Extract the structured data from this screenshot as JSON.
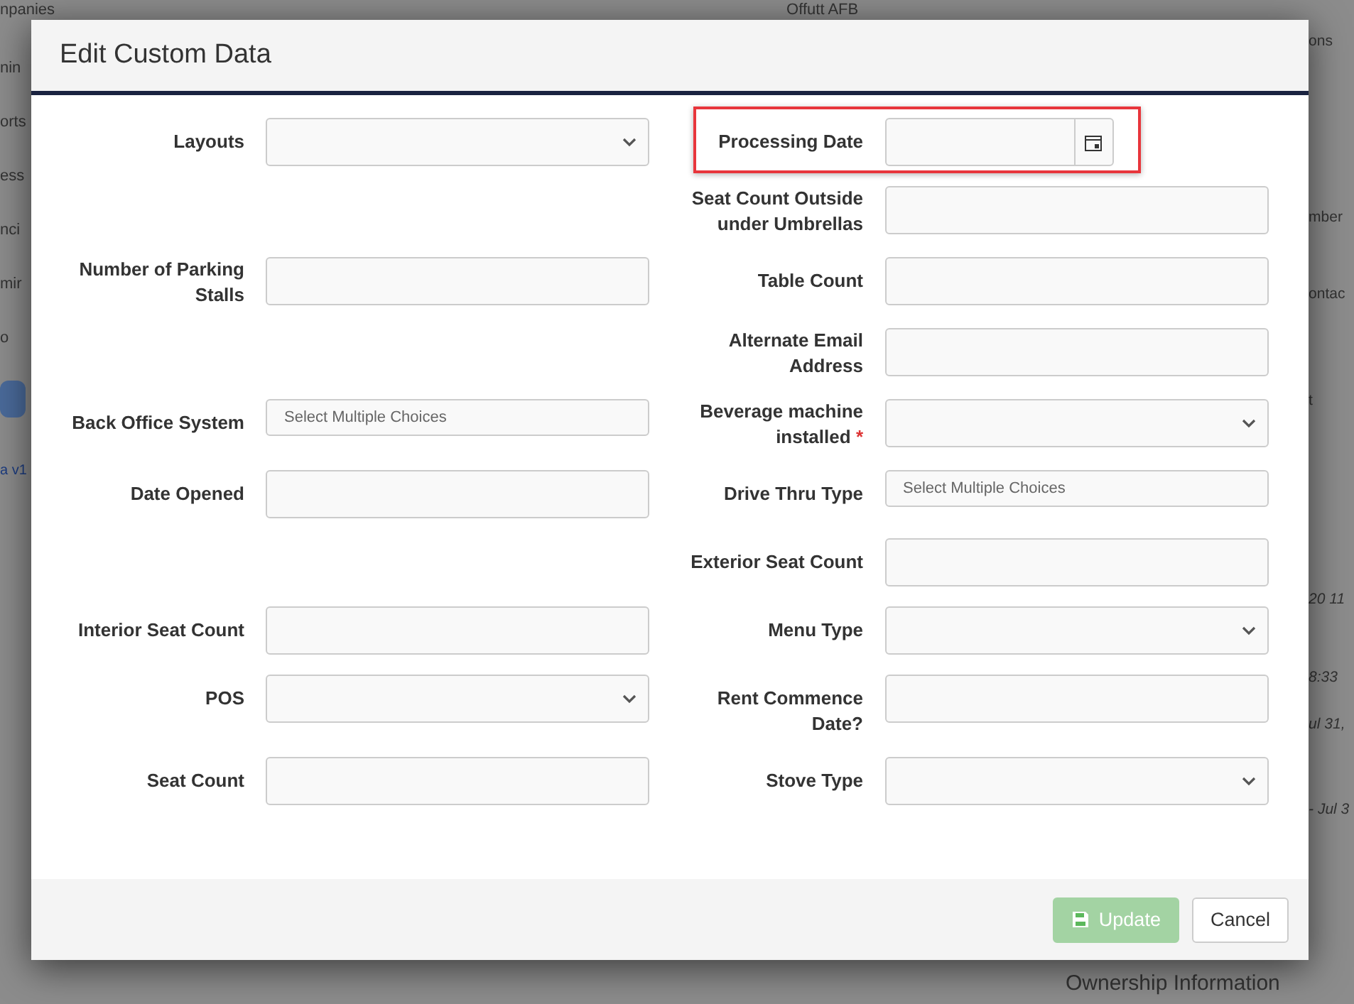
{
  "background": {
    "top_left": "npanies",
    "sidebar_items": [
      "nin",
      "orts",
      "ess",
      "nci",
      "mir",
      "o"
    ],
    "version": "a v1",
    "top_label": "Offutt AFB",
    "right_items": [
      {
        "text": "ons",
        "italic": false
      },
      {
        "text": "mber",
        "italic": false
      },
      {
        "text": "ontac",
        "italic": false
      },
      {
        "text": "t",
        "italic": false
      },
      {
        "text": "20 11",
        "italic": true
      },
      {
        "text": "8:33",
        "italic": true
      },
      {
        "text": "ul 31,",
        "italic": true
      },
      {
        "text": "- Jul 3",
        "italic": true
      }
    ],
    "bottom_heading": "Ownership Information"
  },
  "dialog": {
    "title": "Edit Custom Data",
    "rows": [
      {
        "left": {
          "label": "Layouts",
          "kind": "select"
        },
        "right": {
          "label": "Processing Date",
          "kind": "date",
          "highlighted": true
        }
      },
      {
        "right": {
          "label": "Seat Count Outside under Umbrellas",
          "kind": "text"
        }
      },
      {
        "left": {
          "label": "Number of Parking Stalls",
          "kind": "text"
        },
        "right": {
          "label": "Table Count",
          "kind": "text"
        }
      },
      {
        "right": {
          "label": "Alternate Email Address",
          "kind": "text"
        }
      },
      {
        "left": {
          "label": "Back Office System",
          "kind": "multi",
          "placeholder": "Select Multiple Choices"
        },
        "right": {
          "label": "Beverage machine installed",
          "kind": "select",
          "required_mark": "*"
        }
      },
      {
        "left": {
          "label": "Date Opened",
          "kind": "text"
        },
        "right": {
          "label": "Drive Thru Type",
          "kind": "multi",
          "placeholder": "Select Multiple Choices"
        }
      },
      {
        "right": {
          "label": "Exterior Seat Count",
          "kind": "text"
        }
      },
      {
        "left": {
          "label": "Interior Seat Count",
          "kind": "text"
        },
        "right": {
          "label": "Menu Type",
          "kind": "select"
        }
      },
      {
        "left": {
          "label": "POS",
          "kind": "select"
        },
        "right": {
          "label": "Rent Commence Date?",
          "kind": "text"
        }
      },
      {
        "left": {
          "label": "Seat Count",
          "kind": "text"
        },
        "right": {
          "label": "Stove Type",
          "kind": "select"
        }
      }
    ],
    "buttons": [
      {
        "label": "Update",
        "kind": "primary",
        "disabled": true
      },
      {
        "label": "Cancel",
        "kind": "default",
        "disabled": false
      }
    ]
  }
}
